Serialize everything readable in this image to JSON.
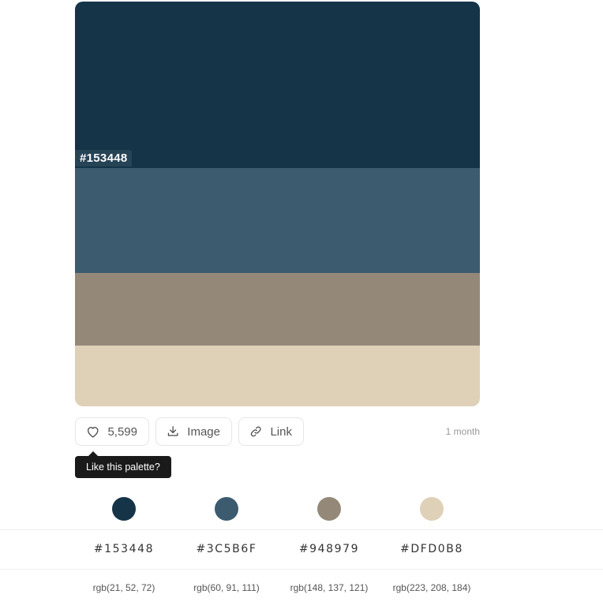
{
  "palette": {
    "bands": [
      {
        "hex": "#153448",
        "label": "#153448"
      },
      {
        "hex": "#3C5B6F",
        "label": ""
      },
      {
        "hex": "#948979",
        "label": ""
      },
      {
        "hex": "#DFD0B8",
        "label": ""
      }
    ]
  },
  "actions": {
    "like_count": "5,599",
    "image_label": "Image",
    "link_label": "Link",
    "time": "1 month"
  },
  "tooltip": {
    "text": "Like this palette?"
  },
  "colors": [
    {
      "hex": "#153448",
      "hex_label": "#153448",
      "rgb": "rgb(21, 52, 72)"
    },
    {
      "hex": "#3C5B6F",
      "hex_label": "#3C5B6F",
      "rgb": "rgb(60, 91, 111)"
    },
    {
      "hex": "#948979",
      "hex_label": "#948979",
      "rgb": "rgb(148, 137, 121)"
    },
    {
      "hex": "#DFD0B8",
      "hex_label": "#DFD0B8",
      "rgb": "rgb(223, 208, 184)"
    }
  ],
  "icons": {
    "like": "heart-icon",
    "image": "download-icon",
    "link": "link-icon"
  }
}
